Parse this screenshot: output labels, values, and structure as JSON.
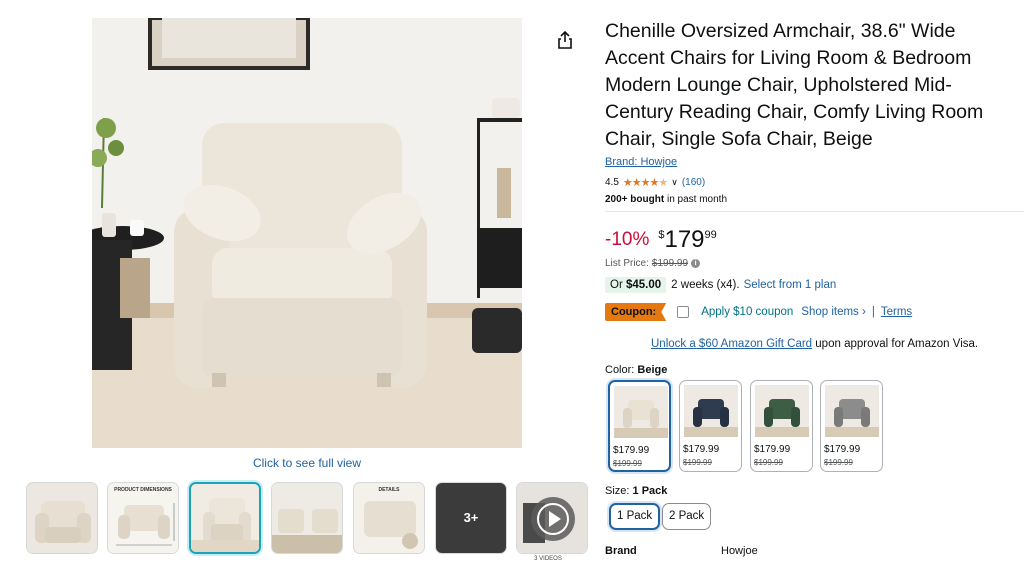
{
  "product": {
    "title": "Chenille Oversized Armchair, 38.6\" Wide Accent Chairs for Living Room & Bedroom Modern Lounge Chair, Upholstered Mid-Century Reading Chair, Comfy Living Room Chair, Single Sofa Chair, Beige",
    "brand_link": "Brand: Howjoe",
    "rating": "4.5",
    "rating_count": "(160)",
    "bought_bold": "200+ bought",
    "bought_rest": " in past month"
  },
  "gallery": {
    "see_full_view": "Click to see full view",
    "thumbnails": [
      {
        "label": "",
        "name": "thumb-1"
      },
      {
        "label": "PRODUCT DIMENSIONS",
        "name": "thumb-2"
      },
      {
        "label": "",
        "name": "thumb-3"
      },
      {
        "label": "",
        "name": "thumb-4"
      },
      {
        "label": "DETAILS",
        "name": "thumb-5"
      }
    ],
    "more_count": "3+",
    "videos_label": "3 VIDEOS"
  },
  "pricing": {
    "discount": "-10%",
    "currency": "$",
    "price_whole": "179",
    "price_fraction": "99",
    "list_price_label": "List Price:",
    "list_price": "$199.99",
    "plan_or": "Or ",
    "plan_amount": "$45.00",
    "plan_terms": "2 weeks (x4).",
    "plan_link": "Select from 1 plan"
  },
  "coupon": {
    "badge": "Coupon:",
    "apply_text": "Apply $10 coupon",
    "shop_items": "Shop items ›",
    "separator": "|",
    "terms": "Terms"
  },
  "gift": {
    "link": "Unlock a $60 Amazon Gift Card",
    "rest": " upon approval for Amazon Visa."
  },
  "color": {
    "label": "Color: ",
    "selected": "Beige",
    "swatches": [
      {
        "price": "$179.99",
        "old_price": "$199.99",
        "chair_color": "#e9e1d3"
      },
      {
        "price": "$179.99",
        "old_price": "$199.99",
        "chair_color": "#2f3b4f"
      },
      {
        "price": "$179.99",
        "old_price": "$199.99",
        "chair_color": "#3d5d45"
      },
      {
        "price": "$179.99",
        "old_price": "$199.99",
        "chair_color": "#8c8c8c"
      }
    ]
  },
  "size": {
    "label": "Size: ",
    "selected": "1 Pack",
    "options": [
      "1 Pack",
      "2 Pack"
    ]
  },
  "specs": {
    "brand_label": "Brand",
    "brand_value": "Howjoe"
  },
  "colors": {
    "link": "#2162a1",
    "discount": "#cc0c39",
    "star": "#de7921",
    "coupon_badge": "#e47911",
    "plan_badge_bg": "#e6f4ec",
    "selected_thumb": "#1ba3b8"
  },
  "icons": {
    "share": "share-icon",
    "stars": "star-rating-icon",
    "chevron": "chevron-down-icon",
    "info": "info-icon",
    "play": "play-icon"
  }
}
